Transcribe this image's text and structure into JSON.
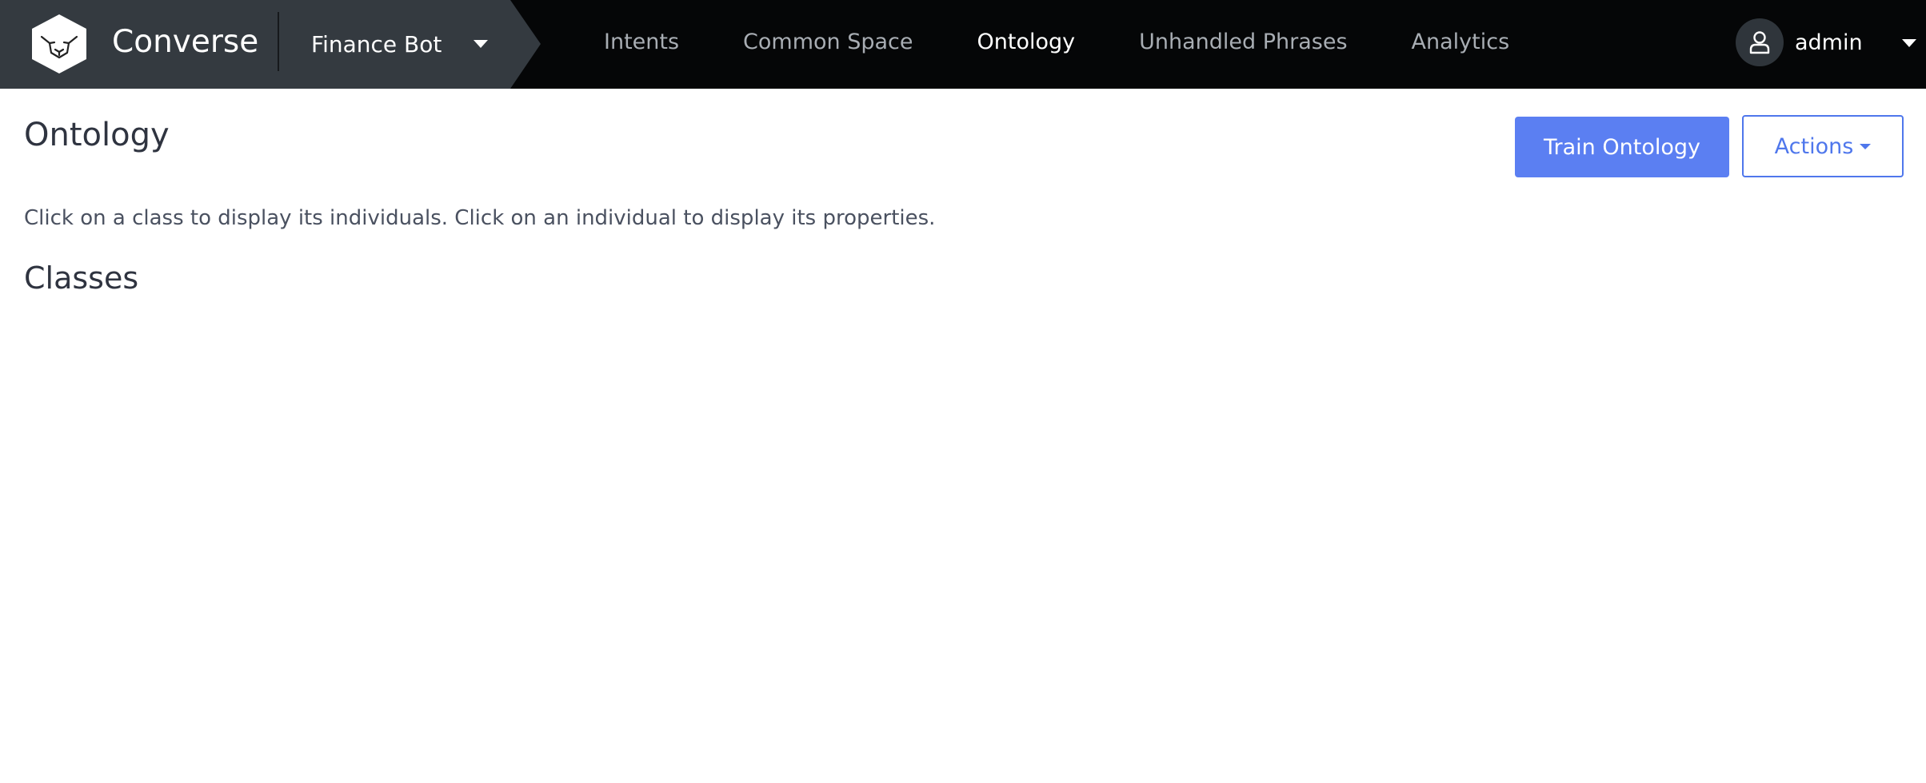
{
  "brand": {
    "name": "Converse",
    "logo_icon": "lion-hexagon-icon"
  },
  "bot_selector": {
    "value": "Finance Bot"
  },
  "nav": {
    "items": [
      {
        "label": "Intents",
        "active": false
      },
      {
        "label": "Common Space",
        "active": false
      },
      {
        "label": "Ontology",
        "active": true
      },
      {
        "label": "Unhandled Phrases",
        "active": false
      },
      {
        "label": "Analytics",
        "active": false
      }
    ]
  },
  "user": {
    "name": "admin",
    "avatar_icon": "user-icon"
  },
  "page": {
    "title": "Ontology",
    "instructions": "Click on a class to display its individuals. Click on an individual to display its properties.",
    "section_title": "Classes"
  },
  "toolbar": {
    "train_label": "Train Ontology",
    "actions_label": "Actions"
  },
  "colors": {
    "navbar_bg": "#050607",
    "brand_bg": "#343a40",
    "primary": "#5b7ff2",
    "outline": "#4f77ec"
  }
}
